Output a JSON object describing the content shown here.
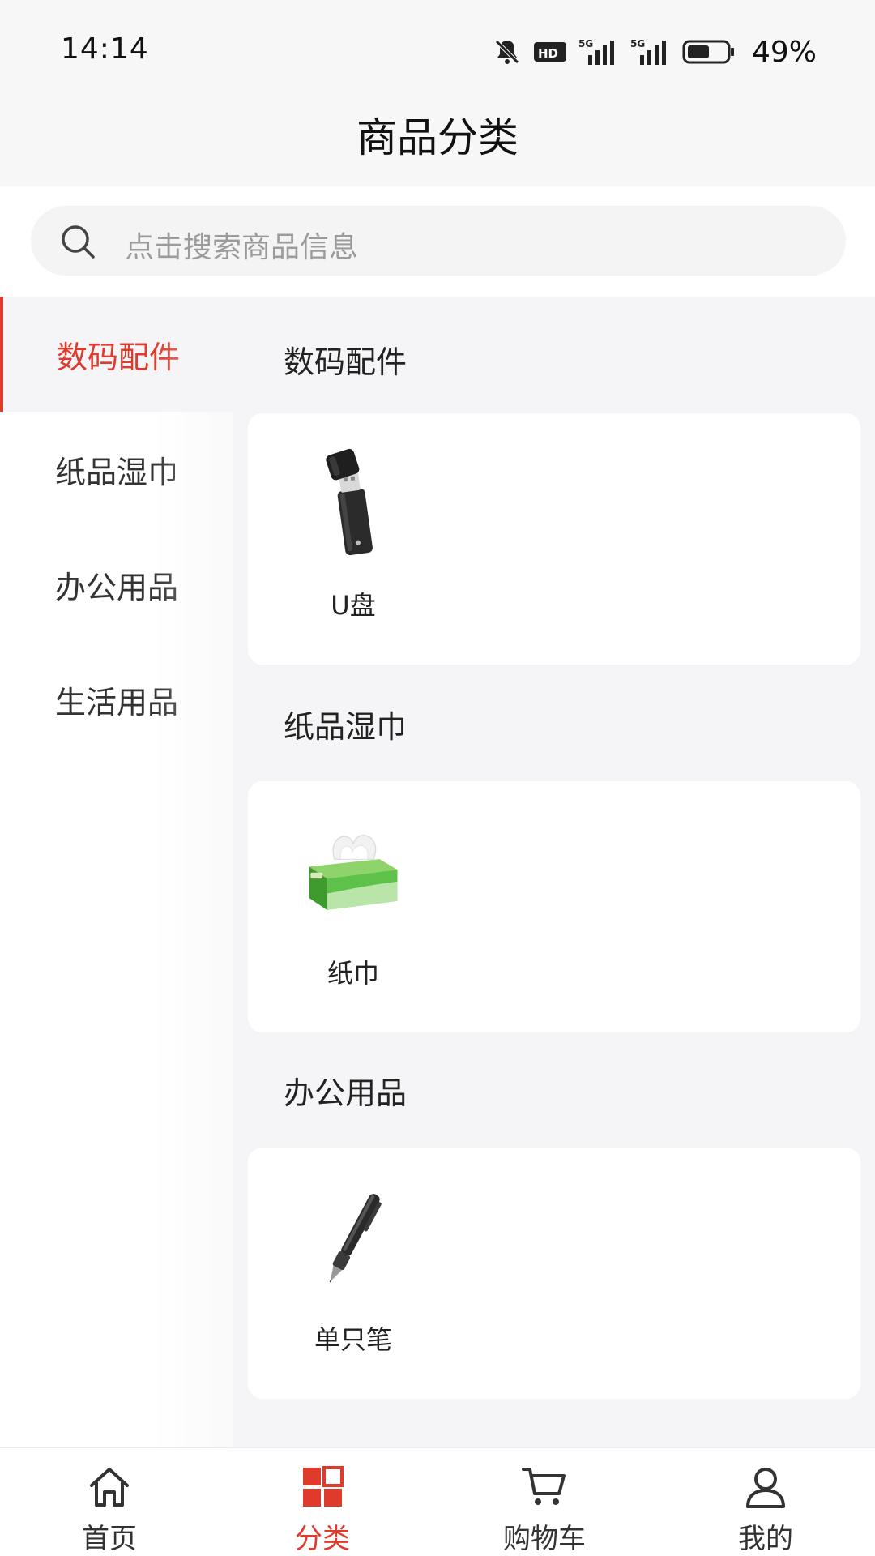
{
  "status_bar": {
    "time": "14:14",
    "battery": "49%",
    "icons": [
      "bell-muted-icon",
      "hd-icon",
      "signal-5g-icon",
      "signal-5g-icon",
      "battery-icon"
    ]
  },
  "header": {
    "title": "商品分类"
  },
  "search": {
    "placeholder": "点击搜索商品信息",
    "icon": "search-icon"
  },
  "sidebar": {
    "items": [
      {
        "label": "数码配件",
        "active": true
      },
      {
        "label": "纸品湿巾",
        "active": false
      },
      {
        "label": "办公用品",
        "active": false
      },
      {
        "label": "生活用品",
        "active": false
      }
    ]
  },
  "sections": [
    {
      "title": "数码配件",
      "products": [
        {
          "name": "U盘",
          "icon": "usb-drive-icon"
        }
      ]
    },
    {
      "title": "纸品湿巾",
      "products": [
        {
          "name": "纸巾",
          "icon": "tissue-box-icon"
        }
      ]
    },
    {
      "title": "办公用品",
      "products": [
        {
          "name": "单只笔",
          "icon": "pen-icon"
        }
      ]
    }
  ],
  "bottom_nav": {
    "items": [
      {
        "label": "首页",
        "icon": "home-icon",
        "active": false
      },
      {
        "label": "分类",
        "icon": "category-grid-icon",
        "active": true
      },
      {
        "label": "购物车",
        "icon": "cart-icon",
        "active": false
      },
      {
        "label": "我的",
        "icon": "user-icon",
        "active": false
      }
    ]
  },
  "colors": {
    "accent": "#e03a2c",
    "background": "#f5f5f7",
    "card": "#ffffff"
  }
}
